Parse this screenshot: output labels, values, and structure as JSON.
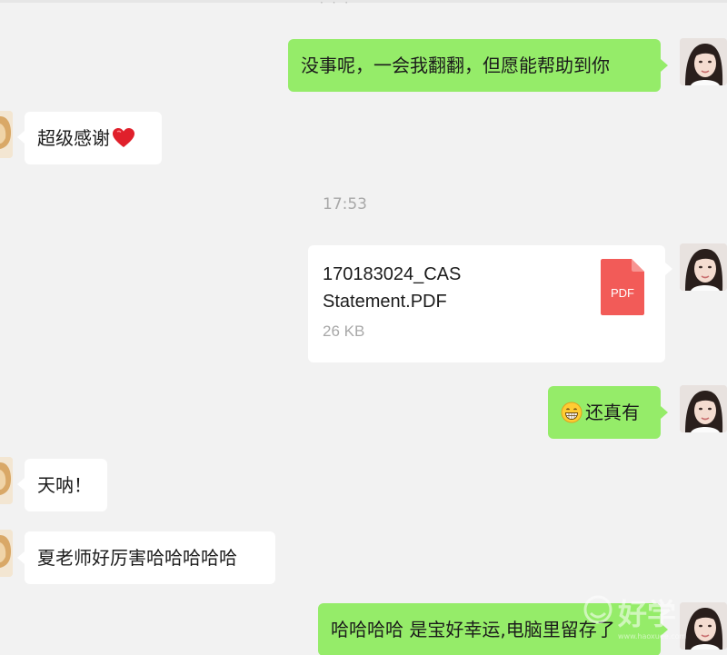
{
  "header": {
    "dots": "· · ·"
  },
  "messages": {
    "m1": {
      "text": "没事呢，一会我翻翻，但愿能帮助到你",
      "direction": "outgoing"
    },
    "m2": {
      "text": "超级感谢",
      "emoji": "red-heart",
      "direction": "incoming"
    },
    "time": "17:53",
    "file": {
      "name_line1": "170183024_CAS",
      "name_line2": "Statement.PDF",
      "size": "26 KB",
      "type": "PDF",
      "direction": "outgoing"
    },
    "m3": {
      "text": "还真有",
      "emoji": "grinning-face",
      "direction": "outgoing"
    },
    "m4": {
      "text": "天呐！",
      "direction": "incoming"
    },
    "m5": {
      "text": "夏老师好厉害哈哈哈哈哈",
      "direction": "incoming"
    },
    "m6": {
      "text": "哈哈哈哈 是宝好幸运,电脑里留存了",
      "direction": "outgoing"
    }
  },
  "colors": {
    "background": "#f2f2f2",
    "outgoing_bubble": "#95ec69",
    "incoming_bubble": "#ffffff",
    "pdf_icon": "#f25b58",
    "timestamp": "#a8a8a8"
  },
  "watermark": {
    "text": "好学"
  }
}
